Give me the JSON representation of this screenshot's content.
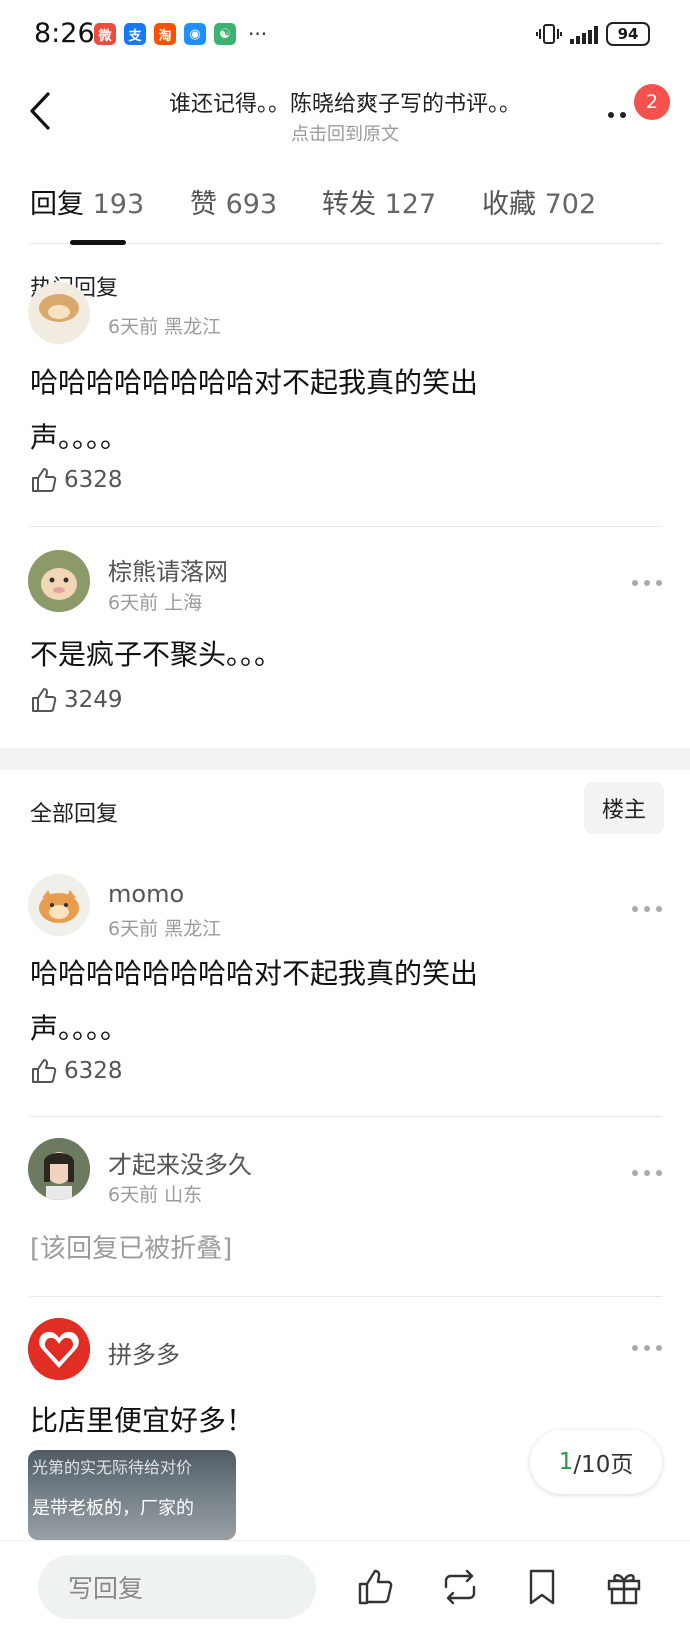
{
  "status_bar": {
    "time": "8:26",
    "apps": [
      {
        "name": "weibo-app-icon",
        "glyph": "微",
        "color": "#f04a3c"
      },
      {
        "name": "alipay-app-icon",
        "glyph": "支",
        "color": "#1677ff"
      },
      {
        "name": "taobao-app-icon",
        "glyph": "淘",
        "color": "#ff5000"
      },
      {
        "name": "message-app-icon",
        "glyph": "◉",
        "color": "#1e90ff"
      },
      {
        "name": "wechat-mini-icon",
        "glyph": "☯",
        "color": "#3cb371"
      }
    ],
    "more": "···",
    "battery": "94"
  },
  "header": {
    "title": "谁还记得。。陈晓给爽子写的书评。。",
    "subtitle": "点击回到原文",
    "notification_count": "2"
  },
  "tabs": [
    {
      "label": "回复",
      "count": "193",
      "active": true
    },
    {
      "label": "赞",
      "count": "693",
      "active": false
    },
    {
      "label": "转发",
      "count": "127",
      "active": false
    },
    {
      "label": "收藏",
      "count": "702",
      "active": false
    }
  ],
  "hot_section": {
    "title": "热门回复",
    "comments": [
      {
        "meta": "6天前 黑龙江",
        "text": "哈哈哈哈哈哈哈哈对不起我真的笑出声。。。。",
        "likes": "6328"
      },
      {
        "name": "棕熊请落网",
        "meta": "6天前 上海",
        "text": "不是疯子不聚头。。。",
        "likes": "3249"
      }
    ]
  },
  "all_section": {
    "title": "全部回复",
    "owner_button": "楼主",
    "comments": [
      {
        "name": "momo",
        "meta": "6天前 黑龙江",
        "text": "哈哈哈哈哈哈哈哈对不起我真的笑出声。。。。",
        "likes": "6328"
      },
      {
        "name": "才起来没多久",
        "meta": "6天前 山东",
        "folded": "[该回复已被折叠]"
      },
      {
        "name": "拼多多",
        "text": "比店里便宜好多！",
        "image_text_1": "光第的实无际待给对价",
        "image_text_2": "是带老板的，厂家的"
      }
    ]
  },
  "pagination": {
    "current": "1",
    "total": "/10页"
  },
  "bottom_bar": {
    "reply_placeholder": "写回复",
    "icons": [
      "like-icon",
      "repost-icon",
      "bookmark-icon",
      "gift-icon"
    ]
  },
  "colors": {
    "accent_green": "#2c9c4b",
    "badge_red": "#f5514d"
  }
}
